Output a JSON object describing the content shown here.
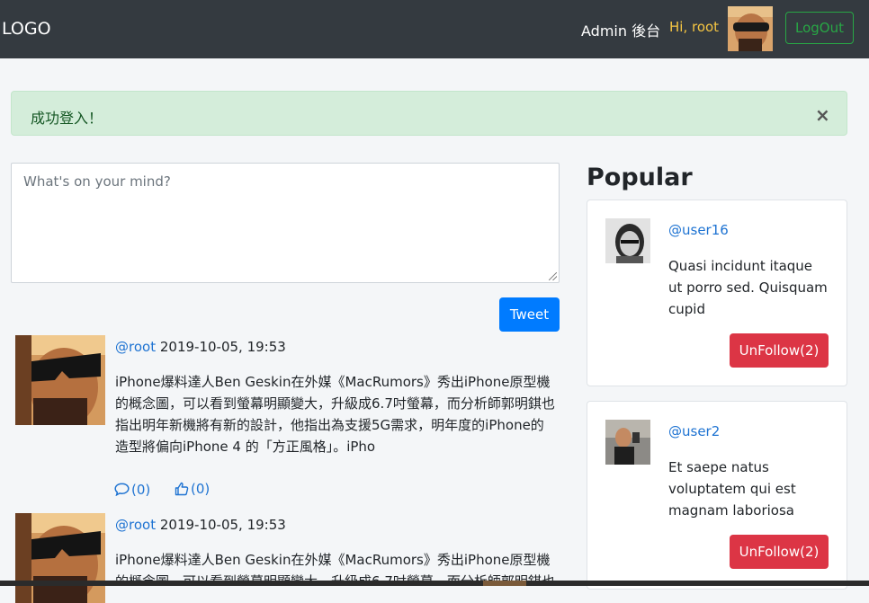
{
  "navbar": {
    "logo": "LOGO",
    "admin_link": "Admin 後台",
    "greeting": "Hi, root",
    "logout_label": "LogOut"
  },
  "alert": {
    "message": "成功登入！",
    "close_symbol": "×"
  },
  "compose": {
    "placeholder": "What's on your mind?",
    "submit_label": "Tweet"
  },
  "tweets": [
    {
      "user": "@root",
      "time": "2019-10-05, 19:53",
      "text": "iPhone爆料達人Ben Geskin在外媒《MacRumors》秀出iPhone原型機的概念圖，可以看到螢幕明顯變大，升級成6.7吋螢幕，而分析師郭明錤也指出明年新機將有新的設計，他指出為支援5G需求，明年度的iPhone的造型將偏向iPhone 4 的「方正風格」。iPho",
      "reply_count": "(0)",
      "like_count": "(0)",
      "reply_icon": "comment-icon",
      "like_icon": "thumbs-up-icon"
    },
    {
      "user": "@root",
      "time": "2019-10-05, 19:53",
      "text": "iPhone爆料達人Ben Geskin在外媒《MacRumors》秀出iPhone原型機的概念圖，可以看到螢幕明顯變大，升級成6.7吋螢幕，而分析師郭明錤也指出明年新機將有新的設計，他指出為支援5G需求，明年度的iPhone的造型將偏向iPhone 4 的「方正風格」。iPho"
    }
  ],
  "popular": {
    "title": "Popular",
    "users": [
      {
        "handle": "@user16",
        "bio": "Quasi incidunt itaque ut porro sed. Quisquam cupid",
        "button": "UnFollow(2)"
      },
      {
        "handle": "@user2",
        "bio": "Et saepe natus voluptatem qui est magnam laboriosa",
        "button": "UnFollow(2)"
      }
    ]
  },
  "colors": {
    "navbar": "#343a40",
    "primary": "#007bff",
    "danger": "#dc3545",
    "success": "#28a745",
    "link": "#1e73d2",
    "alert_bg": "#d4edda"
  }
}
